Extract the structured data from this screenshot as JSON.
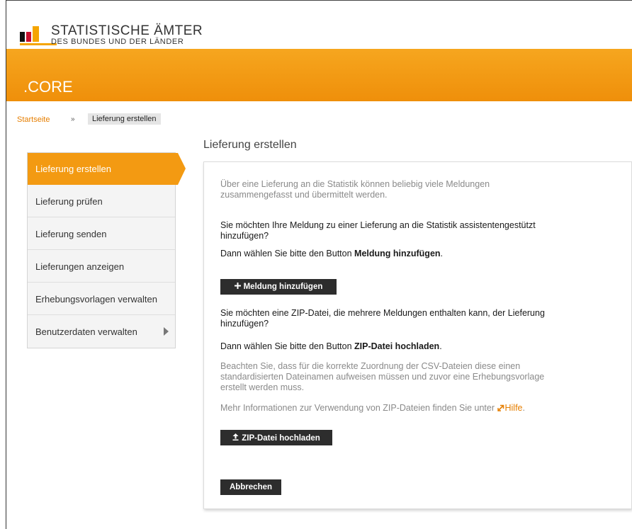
{
  "logo": {
    "line1": "STATISTISCHE ÄMTER",
    "line2": "DES BUNDES UND DER LÄNDER"
  },
  "app": {
    "title": ".CORE"
  },
  "breadcrumb": {
    "home": "Startseite",
    "separator": "»",
    "current": "Lieferung erstellen"
  },
  "sidebar": {
    "items": [
      {
        "label": "Lieferung erstellen",
        "active": true
      },
      {
        "label": "Lieferung prüfen"
      },
      {
        "label": "Lieferung senden"
      },
      {
        "label": "Lieferungen anzeigen"
      },
      {
        "label": "Erhebungsvorlagen verwalten"
      },
      {
        "label": "Benutzerdaten verwalten",
        "has_submenu": true
      }
    ]
  },
  "main": {
    "title": "Lieferung erstellen",
    "intro_l1": "Über eine Lieferung an die Statistik können beliebig viele Meldungen",
    "intro_l2": "zusammengefasst und übermittelt werden.",
    "q1_l1": "Sie möchten Ihre Meldung zu einer Lieferung an die Statistik assistentengestützt",
    "q1_l2": "hinzufügen?",
    "q1_instr_prefix": "Dann wählen Sie bitte den Button ",
    "q1_instr_bold": "Meldung hinzufügen",
    "q1_instr_suffix": ".",
    "add_button": "Meldung hinzufügen",
    "q2_l1": "Sie möchten eine ZIP-Datei, die mehrere Meldungen enthalten kann, der Lieferung",
    "q2_l2": "hinzufügen?",
    "q2_instr_prefix": "Dann wählen Sie bitte den Button ",
    "q2_instr_bold": "ZIP-Datei hochladen",
    "q2_instr_suffix": ".",
    "note_l1": "Beachten Sie, dass für die korrekte Zuordnung der CSV-Dateien diese einen",
    "note_l2": "standardisierten Dateinamen aufweisen müssen und zuvor eine Erhebungsvorlage",
    "note_l3": "erstellt werden muss.",
    "more_info": "Mehr Informationen zur Verwendung von ZIP-Dateien finden Sie unter ",
    "help_link": "Hilfe",
    "help_suffix": ".",
    "upload_button": "ZIP-Datei hochladen",
    "cancel_button": "Abbrechen"
  },
  "colors": {
    "brand_orange": "#f39a12",
    "link_orange": "#e67e00",
    "button_dark": "#2d2d2d"
  },
  "icons": {
    "add": "plus-icon",
    "upload": "upload-icon",
    "external_link": "external-link-icon",
    "submenu": "chevron-right-icon"
  }
}
